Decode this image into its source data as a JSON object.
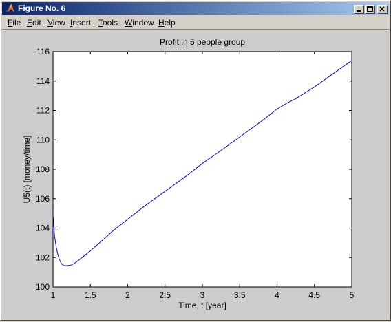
{
  "window": {
    "title": "Figure No. 6",
    "controls": {
      "minimize": "minimize",
      "maximize": "maximize",
      "close": "close"
    }
  },
  "menu": [
    {
      "label": "File",
      "ul": "F",
      "rest": "ile"
    },
    {
      "label": "Edit",
      "ul": "E",
      "rest": "dit"
    },
    {
      "label": "View",
      "ul": "V",
      "rest": "iew"
    },
    {
      "label": "Insert",
      "ul": "I",
      "rest": "nsert"
    },
    {
      "label": "Tools",
      "ul": "T",
      "rest": "ools"
    },
    {
      "label": "Window",
      "ul": "W",
      "rest": "indow"
    },
    {
      "label": "Help",
      "ul": "H",
      "rest": "elp"
    }
  ],
  "chart_data": {
    "type": "line",
    "title": "Profit in 5 people group",
    "xlabel": "Time, t [year]",
    "ylabel": "U5(t) [money/time]",
    "xlim": [
      1,
      5
    ],
    "ylim": [
      100,
      116
    ],
    "xticks": [
      1,
      1.5,
      2,
      2.5,
      3,
      3.5,
      4,
      4.5,
      5
    ],
    "xtick_labels": [
      "1",
      "1.5",
      "2",
      "2.5",
      "3",
      "3.5",
      "4",
      "4.5",
      "5"
    ],
    "yticks": [
      100,
      102,
      104,
      106,
      108,
      110,
      112,
      114,
      116
    ],
    "ytick_labels": [
      "100",
      "102",
      "104",
      "106",
      "108",
      "110",
      "112",
      "114",
      "116"
    ],
    "grid": false,
    "line_color": "#0000ff",
    "series": [
      {
        "x": [
          1.0,
          1.02,
          1.04,
          1.06,
          1.08,
          1.1,
          1.12,
          1.15,
          1.2,
          1.25,
          1.3,
          1.4,
          1.5,
          1.6,
          1.8,
          2.0,
          2.2,
          2.5,
          2.8,
          3.0,
          3.2,
          3.5,
          3.8,
          4.0,
          4.15,
          4.25,
          4.5,
          4.75,
          5.0
        ],
        "y": [
          104.9,
          103.5,
          102.8,
          102.3,
          101.95,
          101.7,
          101.55,
          101.45,
          101.45,
          101.5,
          101.65,
          102.05,
          102.45,
          102.9,
          103.8,
          104.6,
          105.4,
          106.5,
          107.6,
          108.4,
          109.1,
          110.2,
          111.3,
          112.1,
          112.55,
          112.8,
          113.6,
          114.5,
          115.4
        ]
      }
    ]
  }
}
